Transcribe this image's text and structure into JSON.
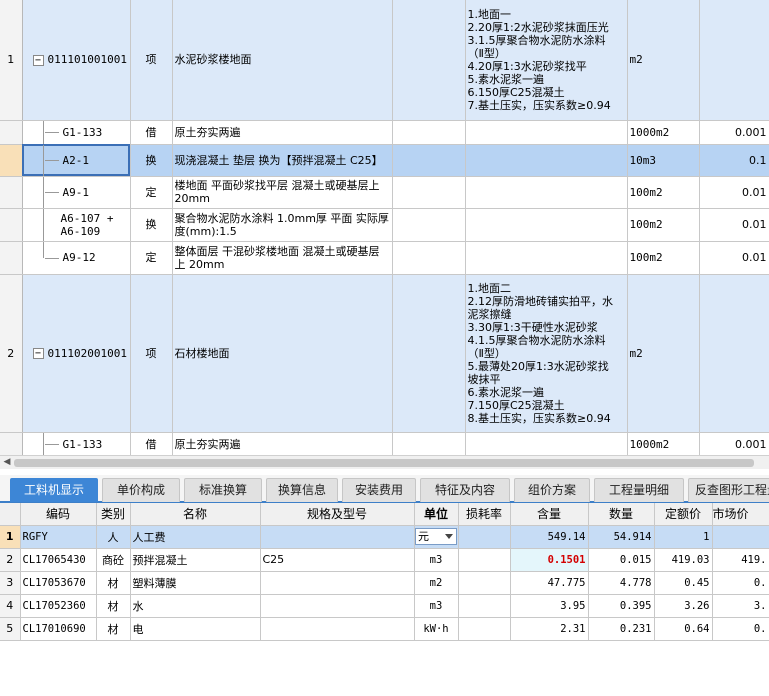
{
  "upper_rows": [
    {
      "kind": "bill",
      "row_no": "1",
      "code": "011101001001",
      "type": "项",
      "name": "水泥砂浆楼地面",
      "spec": "",
      "features": [
        "1.地面一",
        "2.20厚1:2水泥砂浆抹面压光",
        "3.1.5厚聚合物水泥防水涂料",
        "（Ⅱ型）",
        "4.20厚1:3水泥砂浆找平",
        "5.素水泥浆一遍",
        "6.150厚C25混凝土",
        "7.基土压实，压实系数≥0.94"
      ],
      "unit": "m2",
      "qty": ""
    },
    {
      "kind": "quota",
      "row_no": "",
      "code": "G1-133",
      "type": "借",
      "name": "原土夯实两遍",
      "spec": "",
      "features": [],
      "unit": "1000m2",
      "qty": "0.001"
    },
    {
      "kind": "quota",
      "row_no": "",
      "code": "A2-1",
      "type": "换",
      "name": "现浇混凝土 垫层  换为【预拌混凝土 C25】",
      "spec": "",
      "features": [],
      "unit": "10m3",
      "qty": "0.1",
      "selected": true
    },
    {
      "kind": "quota",
      "row_no": "",
      "code": "A9-1",
      "type": "定",
      "name": "楼地面 平面砂浆找平层 混凝土或硬基层上 20mm",
      "spec": "",
      "features": [],
      "unit": "100m2",
      "qty": "0.01"
    },
    {
      "kind": "quota",
      "row_no": "",
      "code": "A6-107 + A6-109",
      "type": "换",
      "name": "聚合物水泥防水涂料 1.0mm厚 平面  实际厚度(mm):1.5",
      "spec": "",
      "features": [],
      "unit": "100m2",
      "qty": "0.01"
    },
    {
      "kind": "quota",
      "row_no": "",
      "code": "A9-12",
      "type": "定",
      "name": "整体面层 干混砂浆楼地面 混凝土或硬基层上 20mm",
      "spec": "",
      "features": [],
      "unit": "100m2",
      "qty": "0.01"
    },
    {
      "kind": "bill",
      "row_no": "2",
      "code": "011102001001",
      "type": "项",
      "name": "石材楼地面",
      "spec": "",
      "features": [
        "1.地面二",
        "2.12厚防滑地砖铺实拍平，水",
        "泥浆擦缝",
        "3.30厚1:3干硬性水泥砂浆",
        "4.1.5厚聚合物水泥防水涂料",
        "（Ⅱ型）",
        "5.最薄处20厚1:3水泥砂浆找",
        "坡抹平",
        "6.素水泥浆一遍",
        "7.150厚C25混凝土",
        "8.基土压实，压实系数≥0.94"
      ],
      "unit": "m2",
      "qty": ""
    },
    {
      "kind": "quota",
      "row_no": "",
      "code": "G1-133",
      "type": "借",
      "name": "原土夯实两遍",
      "spec": "",
      "features": [],
      "unit": "1000m2",
      "qty": "0.001"
    }
  ],
  "tabs": [
    "工料机显示",
    "单价构成",
    "标准换算",
    "换算信息",
    "安装费用",
    "特征及内容",
    "组价方案",
    "工程量明细",
    "反查图形工程量"
  ],
  "active_tab": 0,
  "lower_headers": [
    "",
    "编码",
    "类别",
    "名称",
    "规格及型号",
    "单位",
    "损耗率",
    "含量",
    "数量",
    "定额价",
    "市场价"
  ],
  "lower_rows": [
    {
      "no": "1",
      "code": "RGFY",
      "category": "人",
      "name": "人工费",
      "spec": "",
      "unit": "元",
      "loss": "",
      "content": "549.14",
      "qty": "54.914",
      "quota_price": "1",
      "market_price": ""
    },
    {
      "no": "2",
      "code": "CL17065430",
      "category": "商砼",
      "name": "预拌混凝土",
      "spec": "C25",
      "unit": "m3",
      "loss": "",
      "content": "0.1501",
      "qty": "0.015",
      "quota_price": "419.03",
      "market_price": "419."
    },
    {
      "no": "3",
      "code": "CL17053670",
      "category": "材",
      "name": "塑料薄膜",
      "spec": "",
      "unit": "m2",
      "loss": "",
      "content": "47.775",
      "qty": "4.778",
      "quota_price": "0.45",
      "market_price": "0."
    },
    {
      "no": "4",
      "code": "CL17052360",
      "category": "材",
      "name": "水",
      "spec": "",
      "unit": "m3",
      "loss": "",
      "content": "3.95",
      "qty": "0.395",
      "quota_price": "3.26",
      "market_price": "3."
    },
    {
      "no": "5",
      "code": "CL17010690",
      "category": "材",
      "name": "电",
      "spec": "",
      "unit": "kW·h",
      "loss": "",
      "content": "2.31",
      "qty": "0.231",
      "quota_price": "0.64",
      "market_price": "0."
    }
  ],
  "icons": {
    "collapse": "minus-box-icon",
    "dropdown": "chevron-down-icon",
    "scroll_left": "arrow-left-icon"
  }
}
